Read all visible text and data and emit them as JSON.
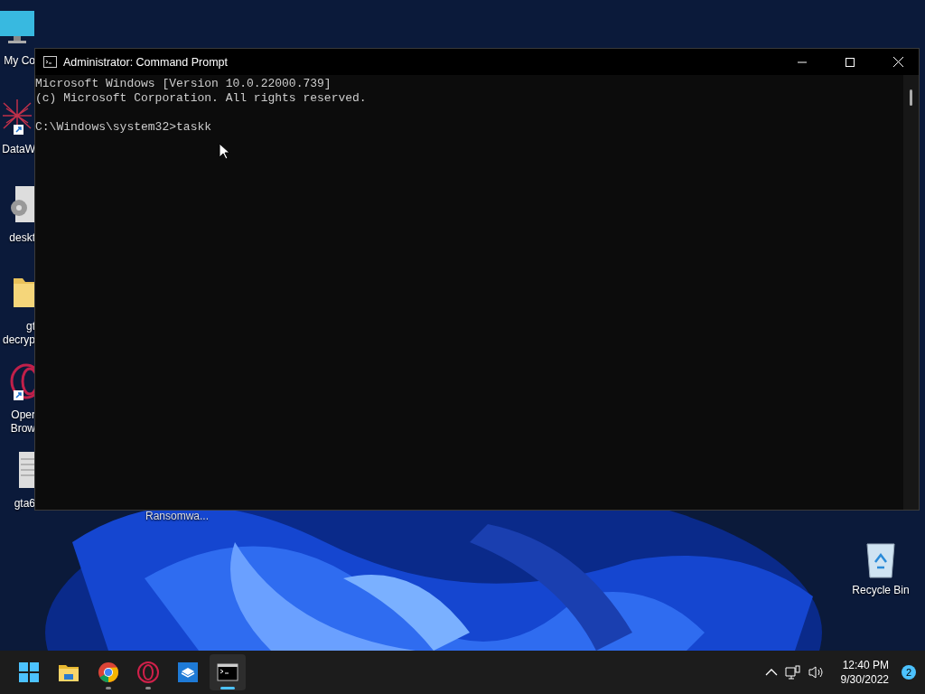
{
  "desktop_icons": [
    {
      "kind": "monitor",
      "lines": [
        "My Co"
      ],
      "shortcut": false
    },
    {
      "kind": "app",
      "lines": [
        "DataW"
      ],
      "shortcut": true
    },
    {
      "kind": "gear-file",
      "lines": [
        "deskt"
      ],
      "shortcut": false
    },
    {
      "kind": "folder",
      "lines": [
        "gt",
        "decryp"
      ],
      "shortcut": false
    },
    {
      "kind": "opera",
      "lines": [
        "Oper",
        "Brow"
      ],
      "shortcut": true
    },
    {
      "kind": "text-file",
      "lines": [
        "gta6"
      ],
      "shortcut": false
    }
  ],
  "hidden_icon_label": "Ransomwa...",
  "recycle_bin": {
    "label": "Recycle Bin"
  },
  "window": {
    "title": "Administrator: Command Prompt",
    "console_banner": [
      "Microsoft Windows [Version 10.0.22000.739]",
      "(c) Microsoft Corporation. All rights reserved."
    ],
    "console_prompt": "C:\\Windows\\system32>taskk"
  },
  "taskbar": {
    "items": [
      {
        "kind": "start",
        "selected": false,
        "running": false
      },
      {
        "kind": "folder",
        "selected": false,
        "running": false
      },
      {
        "kind": "chrome",
        "selected": false,
        "running": true
      },
      {
        "kind": "opera",
        "selected": false,
        "running": true
      },
      {
        "kind": "sandbox",
        "selected": false,
        "running": false
      },
      {
        "kind": "terminal",
        "selected": true,
        "running": true
      }
    ],
    "time": "12:40 PM",
    "date": "9/30/2022",
    "notifications": "2"
  }
}
